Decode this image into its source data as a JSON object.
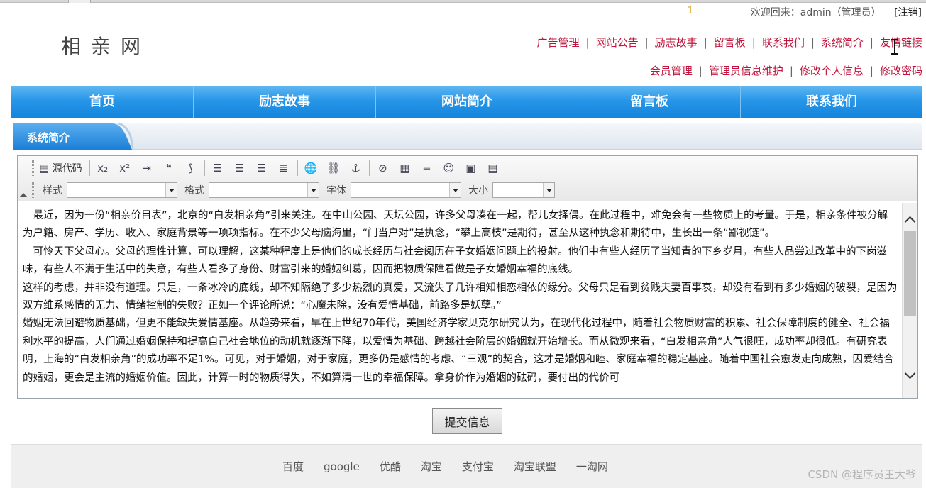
{
  "header": {
    "badge": "1",
    "welcome": "欢迎回来：admin（管理员）",
    "logout": "[注销]",
    "logo": "相亲网",
    "links_row1": [
      "广告管理",
      "网站公告",
      "励志故事",
      "留言板",
      "联系我们",
      "系统简介",
      "友情链接"
    ],
    "links_row2": [
      "会员管理",
      "管理员信息维护",
      "修改个人信息",
      "修改密码"
    ]
  },
  "nav": [
    "首页",
    "励志故事",
    "网站简介",
    "留言板",
    "联系我们"
  ],
  "section": {
    "title": "系统简介"
  },
  "editor": {
    "toolbar": {
      "source_label": "源代码",
      "style_label": "样式",
      "format_label": "格式",
      "font_label": "字体",
      "size_label": "大小"
    },
    "paragraphs": [
      "　最近，因为一份“相亲价目表”，北京的“白发相亲角”引来关注。在中山公园、天坛公园，许多父母凑在一起，帮儿女择偶。在此过程中，难免会有一些物质上的考量。于是，相亲条件被分解为户籍、房产、学历、收入、家庭背景等一项项指标。在不少父母脑海里，“门当户对”是执念，“攀上高枝”是期待，甚至从这种执念和期待中，生长出一条“鄙视链”。",
      "　可怜天下父母心。父母的理性计算，可以理解，这某种程度上是他们的成长经历与社会阅历在子女婚姻问题上的投射。他们中有些人经历了当知青的下乡岁月，有些人品尝过改革中的下岗滋味，有些人不满于生活中的失意，有些人看多了身份、财富引来的婚姻纠葛，因而把物质保障看做是子女婚姻幸福的底线。",
      "这样的考虑，并非没有道理。只是，一条冰冷的底线，却不知隔绝了多少热烈的真爱，又流失了几许相知相恋相依的缘分。父母只是看到贫贱夫妻百事哀，却没有看到有多少婚姻的破裂，是因为双方维系感情的无力、情绪控制的失败？正如一个评论所说：“心魔未除，没有爱情基础，前路多是妖孽。”",
      "婚姻无法回避物质基础，但更不能缺失爱情基座。从趋势来看，早在上世纪70年代，美国经济学家贝克尔研究认为，在现代化过程中，随着社会物质财富的积累、社会保障制度的健全、社会福利水平的提高，人们通过婚姻保持和提高自己社会地位的动机就逐渐下降，以爱情为基础、跨越社会阶层的婚姻就开始增长。而从微观来看，“白发相亲角”人气很旺，成功率却很低。有研究表明，上海的“白发相亲角”的成功率不足1%。可见，对于婚姻，对于家庭，更多仍是感情的考虑、“三观”的契合，这才是婚姻和睦、家庭幸福的稳定基座。随着中国社会愈发走向成熟，因爱结合的婚姻，更会是主流的婚姻价值。因此，计算一时的物质得失，不如算清一世的幸福保障。拿身价作为婚姻的砝码，要付出的代价可"
    ]
  },
  "submit_label": "提交信息",
  "footer": {
    "links": [
      "百度",
      "google",
      "优酷",
      "淘宝",
      "支付宝",
      "淘宝联盟",
      "一淘网"
    ]
  },
  "watermark": "CSDN @程序员王大爷"
}
